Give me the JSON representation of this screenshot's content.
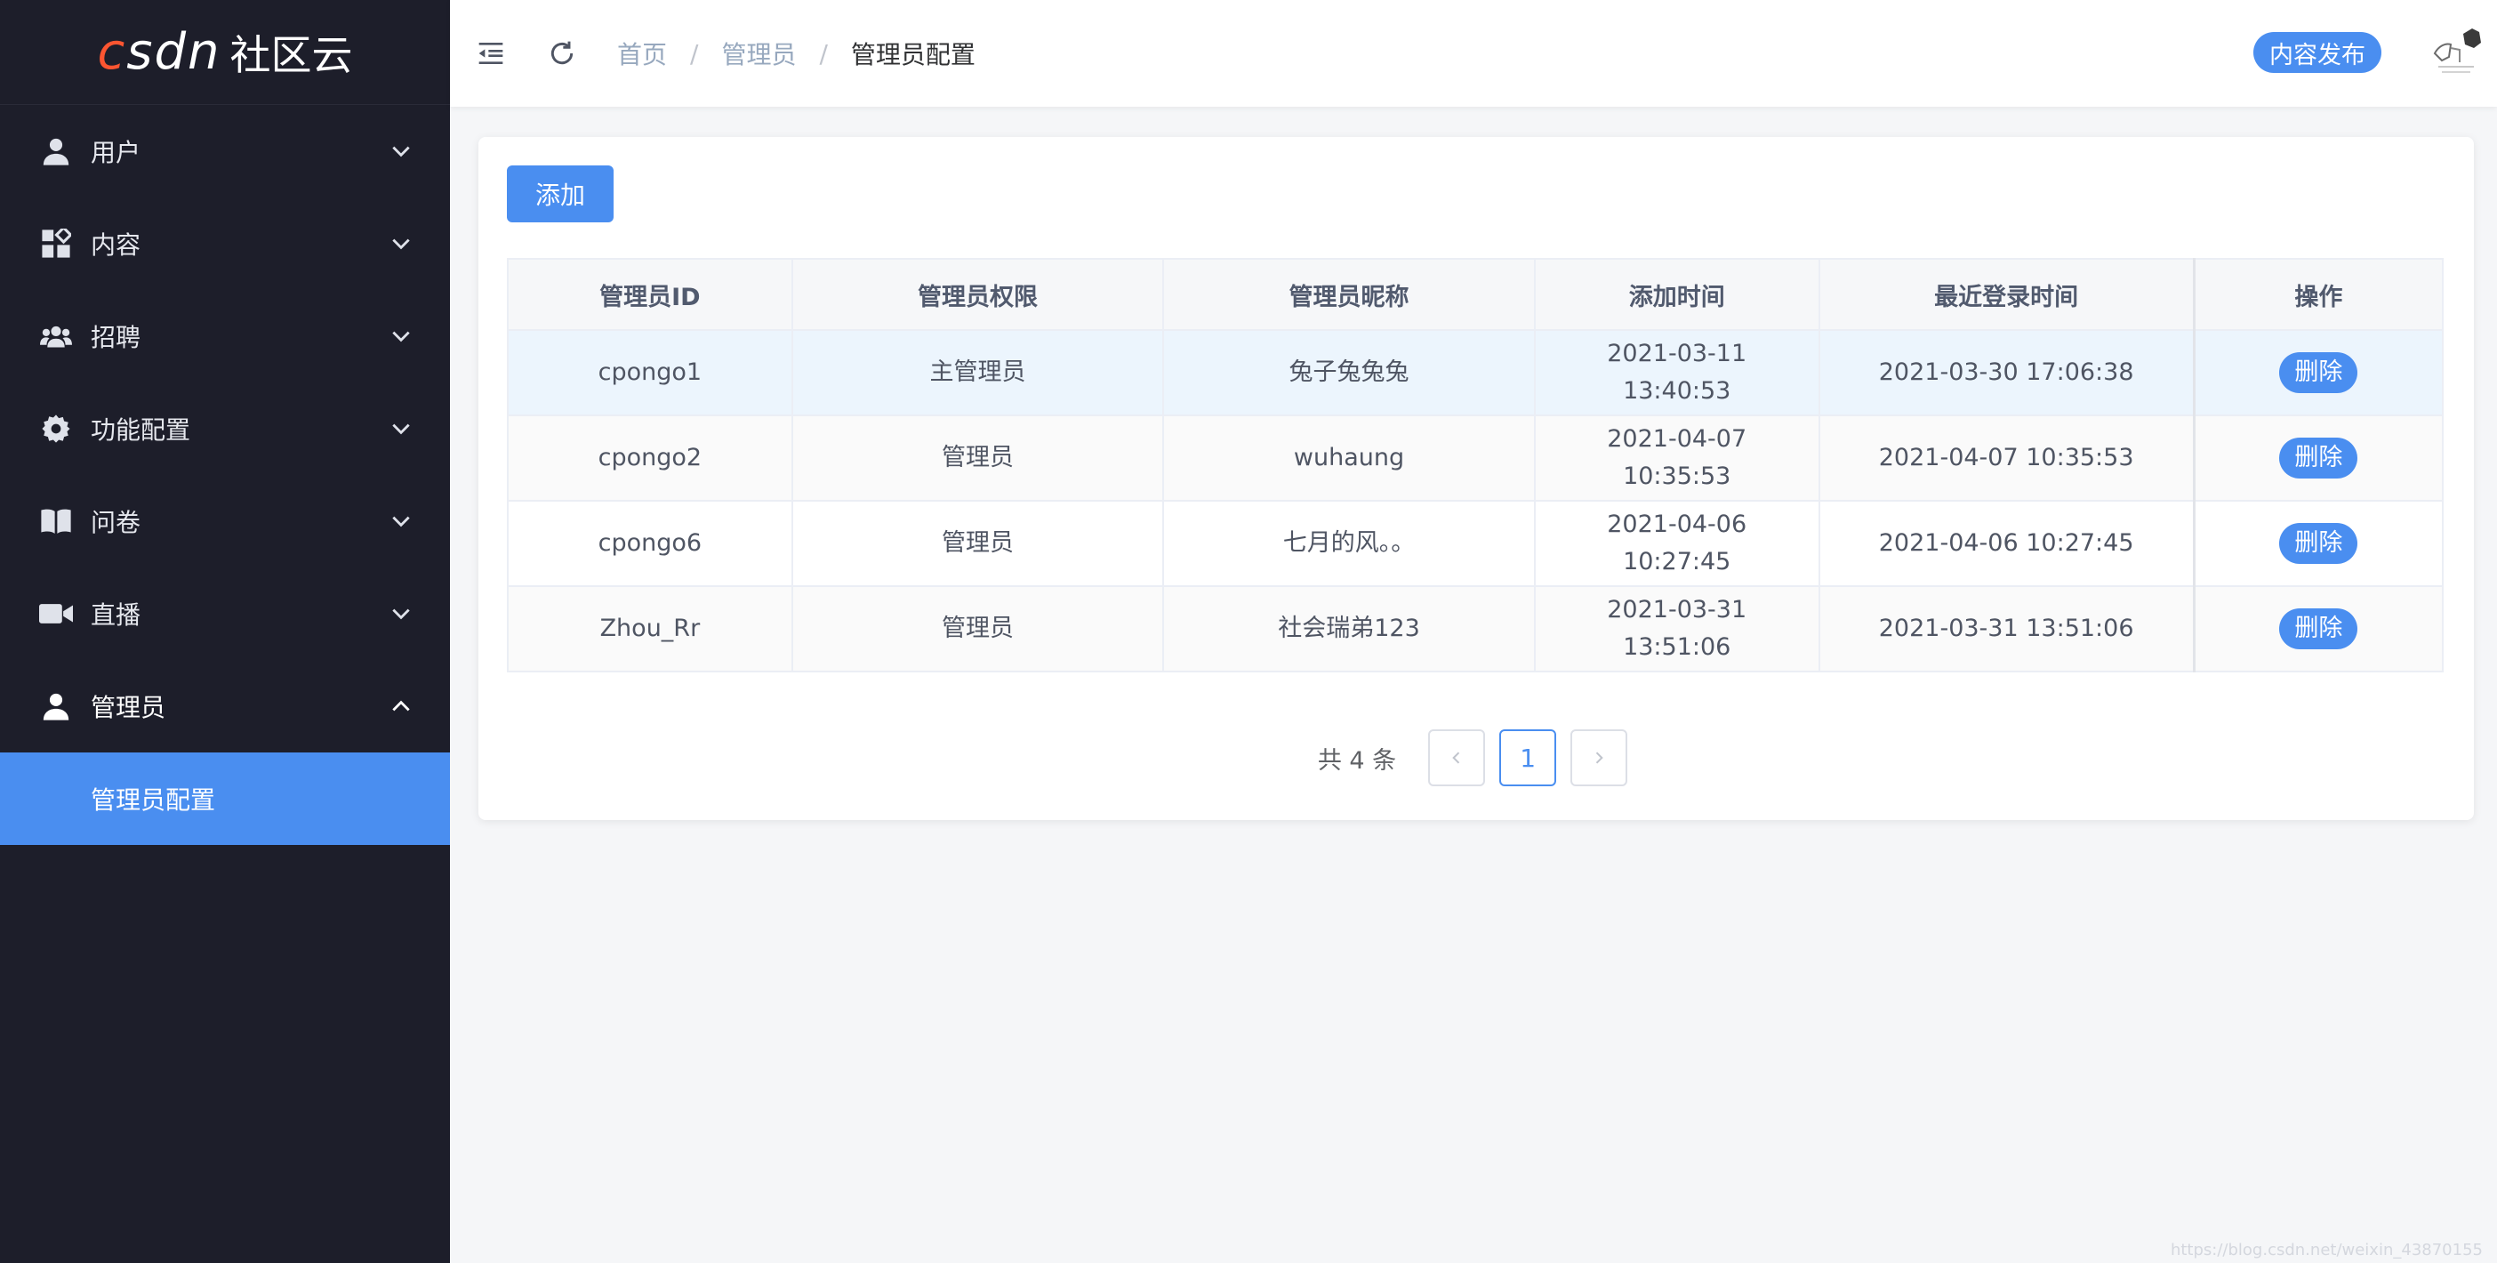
{
  "brand": {
    "logo_text": "csdn",
    "logo_suffix": "社区云",
    "accent": "#fc5531"
  },
  "sidebar": {
    "items": [
      {
        "label": "用户",
        "icon": "user-icon"
      },
      {
        "label": "内容",
        "icon": "apps-icon"
      },
      {
        "label": "招聘",
        "icon": "group-icon"
      },
      {
        "label": "功能配置",
        "icon": "gear-icon"
      },
      {
        "label": "问卷",
        "icon": "book-icon"
      },
      {
        "label": "直播",
        "icon": "video-camera-icon"
      },
      {
        "label": "管理员",
        "icon": "user-icon",
        "expanded": true
      }
    ],
    "active_sub_item": "管理员配置"
  },
  "header": {
    "breadcrumb": [
      "首页",
      "管理员",
      "管理员配置"
    ],
    "breadcrumb_separator": "/",
    "publish_label": "内容发布"
  },
  "main": {
    "add_label": "添加",
    "table": {
      "columns": [
        "管理员ID",
        "管理员权限",
        "管理员昵称",
        "添加时间",
        "最近登录时间",
        "操作"
      ],
      "rows": [
        {
          "id": "cpongo1",
          "role": "主管理员",
          "nickname": "兔子兔兔兔",
          "added": "2021-03-11 13:40:53",
          "last_login": "2021-03-30 17:06:38",
          "action": "删除"
        },
        {
          "id": "cpongo2",
          "role": "管理员",
          "nickname": "wuhaung",
          "added": "2021-04-07 10:35:53",
          "last_login": "2021-04-07 10:35:53",
          "action": "删除"
        },
        {
          "id": "cpongo6",
          "role": "管理员",
          "nickname": "七月的风。。",
          "added": "2021-04-06 10:27:45",
          "last_login": "2021-04-06 10:27:45",
          "action": "删除"
        },
        {
          "id": "Zhou_Rr",
          "role": "管理员",
          "nickname": "社会瑞弟123",
          "added": "2021-03-31 13:51:06",
          "last_login": "2021-03-31 13:51:06",
          "action": "删除"
        }
      ]
    },
    "pagination": {
      "total_text": "共 4 条",
      "current_page": "1"
    }
  },
  "colors": {
    "sidebar_bg": "#1d1e2a",
    "primary": "#4a8ef0",
    "page_bg": "#f5f6f8"
  },
  "watermark": "https://blog.csdn.net/weixin_43870155"
}
